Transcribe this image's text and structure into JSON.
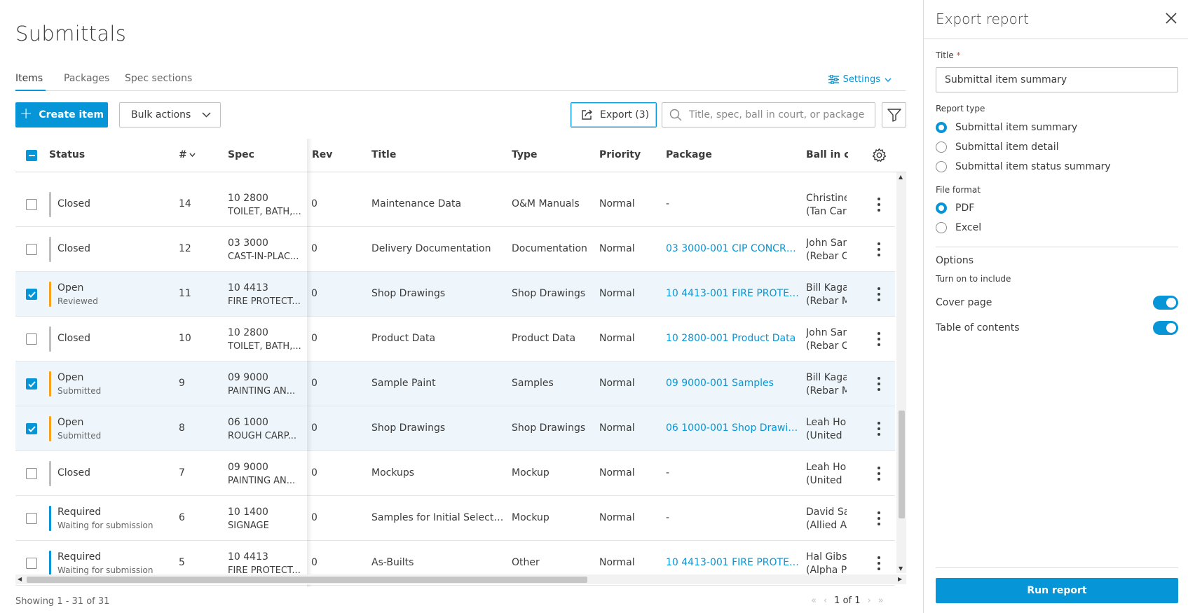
{
  "page": {
    "title": "Submittals"
  },
  "tabs": [
    {
      "label": "Items",
      "active": true
    },
    {
      "label": "Packages",
      "active": false
    },
    {
      "label": "Spec sections",
      "active": false
    }
  ],
  "settings_label": "Settings",
  "toolbar": {
    "create_label": "Create item",
    "bulk_label": "Bulk actions",
    "export_label": "Export (3)",
    "search_placeholder": "Title, spec, ball in court, or package"
  },
  "columns": {
    "status": "Status",
    "number": "#",
    "spec": "Spec",
    "rev": "Rev",
    "title": "Title",
    "type": "Type",
    "priority": "Priority",
    "package": "Package",
    "ball": "Ball in co"
  },
  "rows": [
    {
      "selected": false,
      "status": "Closed",
      "substatus": "",
      "bar_color": "#bfbfbf",
      "num": "14",
      "spec_code": "10 2800",
      "spec_name": "TOILET, BATH,...",
      "rev": "0",
      "title": "Maintenance Data",
      "type": "O&M Manuals",
      "priority": "Normal",
      "package": "-",
      "package_link": false,
      "ball_name": "Christine",
      "ball_company": "(Tan Car"
    },
    {
      "selected": false,
      "status": "Closed",
      "substatus": "",
      "bar_color": "#bfbfbf",
      "num": "12",
      "spec_code": "03 3000",
      "spec_name": "CAST-IN-PLAC...",
      "rev": "0",
      "title": "Delivery Documentation",
      "type": "Documentation",
      "priority": "Normal",
      "package": "03 3000-001 CIP CONCRE...",
      "package_link": true,
      "ball_name": "John Sar",
      "ball_company": "(Rebar C"
    },
    {
      "selected": true,
      "status": "Open",
      "substatus": "Reviewed",
      "bar_color": "#faa21b",
      "num": "11",
      "spec_code": "10 4413",
      "spec_name": "FIRE PROTECT...",
      "rev": "0",
      "title": "Shop Drawings",
      "type": "Shop Drawings",
      "priority": "Normal",
      "package": "10 4413-001 FIRE PROTEC...",
      "package_link": true,
      "ball_name": "Bill Kaga",
      "ball_company": "(Rebar M"
    },
    {
      "selected": false,
      "status": "Closed",
      "substatus": "",
      "bar_color": "#bfbfbf",
      "num": "10",
      "spec_code": "10 2800",
      "spec_name": "TOILET, BATH,...",
      "rev": "0",
      "title": "Product Data",
      "type": "Product Data",
      "priority": "Normal",
      "package": "10 2800-001 Product Data",
      "package_link": true,
      "ball_name": "John Sar",
      "ball_company": "(Rebar C"
    },
    {
      "selected": true,
      "status": "Open",
      "substatus": "Submitted",
      "bar_color": "#faa21b",
      "num": "9",
      "spec_code": "09 9000",
      "spec_name": "PAINTING AN...",
      "rev": "0",
      "title": "Sample Paint",
      "type": "Samples",
      "priority": "Normal",
      "package": "09 9000-001 Samples",
      "package_link": true,
      "ball_name": "Bill Kaga",
      "ball_company": "(Rebar M"
    },
    {
      "selected": true,
      "status": "Open",
      "substatus": "Submitted",
      "bar_color": "#faa21b",
      "num": "8",
      "spec_code": "06 1000",
      "spec_name": "ROUGH CARP...",
      "rev": "0",
      "title": "Shop Drawings",
      "type": "Shop Drawings",
      "priority": "Normal",
      "package": "06 1000-001 Shop Drawin...",
      "package_link": true,
      "ball_name": "Leah Ho",
      "ball_company": "(United"
    },
    {
      "selected": false,
      "status": "Closed",
      "substatus": "",
      "bar_color": "#bfbfbf",
      "num": "7",
      "spec_code": "09 9000",
      "spec_name": "PAINTING AN...",
      "rev": "0",
      "title": "Mockups",
      "type": "Mockup",
      "priority": "Normal",
      "package": "-",
      "package_link": false,
      "ball_name": "Leah Ho",
      "ball_company": "(United"
    },
    {
      "selected": false,
      "status": "Required",
      "substatus": "Waiting for submission",
      "bar_color": "#0696d7",
      "num": "6",
      "spec_code": "10 1400",
      "spec_name": "SIGNAGE",
      "rev": "0",
      "title": "Samples for Initial Selecti...",
      "type": "Mockup",
      "priority": "Normal",
      "package": "-",
      "package_link": false,
      "ball_name": "David Sa",
      "ball_company": "(Allied A"
    },
    {
      "selected": false,
      "status": "Required",
      "substatus": "Waiting for submission",
      "bar_color": "#0696d7",
      "num": "5",
      "spec_code": "10 4413",
      "spec_name": "FIRE PROTECT...",
      "rev": "0",
      "title": "As-Builts",
      "type": "Other",
      "priority": "Normal",
      "package": "10 4413-001 FIRE PROTEC...",
      "package_link": true,
      "ball_name": "Hal Gibs",
      "ball_company": "(Alpha P"
    }
  ],
  "footer": {
    "showing": "Showing 1 - 31 of 31",
    "page": "1 of 1"
  },
  "panel": {
    "title": "Export report",
    "title_label": "Title",
    "title_required_mark": "*",
    "title_value": "Submittal item summary",
    "report_type_label": "Report type",
    "report_types": [
      {
        "label": "Submittal item summary",
        "selected": true
      },
      {
        "label": "Submittal item detail",
        "selected": false
      },
      {
        "label": "Submittal item status summary",
        "selected": false
      }
    ],
    "file_format_label": "File format",
    "file_formats": [
      {
        "label": "PDF",
        "selected": true
      },
      {
        "label": "Excel",
        "selected": false
      }
    ],
    "options_label": "Options",
    "options_hint": "Turn on to include",
    "toggles": [
      {
        "label": "Cover page",
        "on": true
      },
      {
        "label": "Table of contents",
        "on": true
      }
    ],
    "run_label": "Run report"
  },
  "colors": {
    "accent": "#0696d7",
    "open": "#faa21b",
    "closed": "#bfbfbf",
    "selected_row": "#eef6fb"
  }
}
